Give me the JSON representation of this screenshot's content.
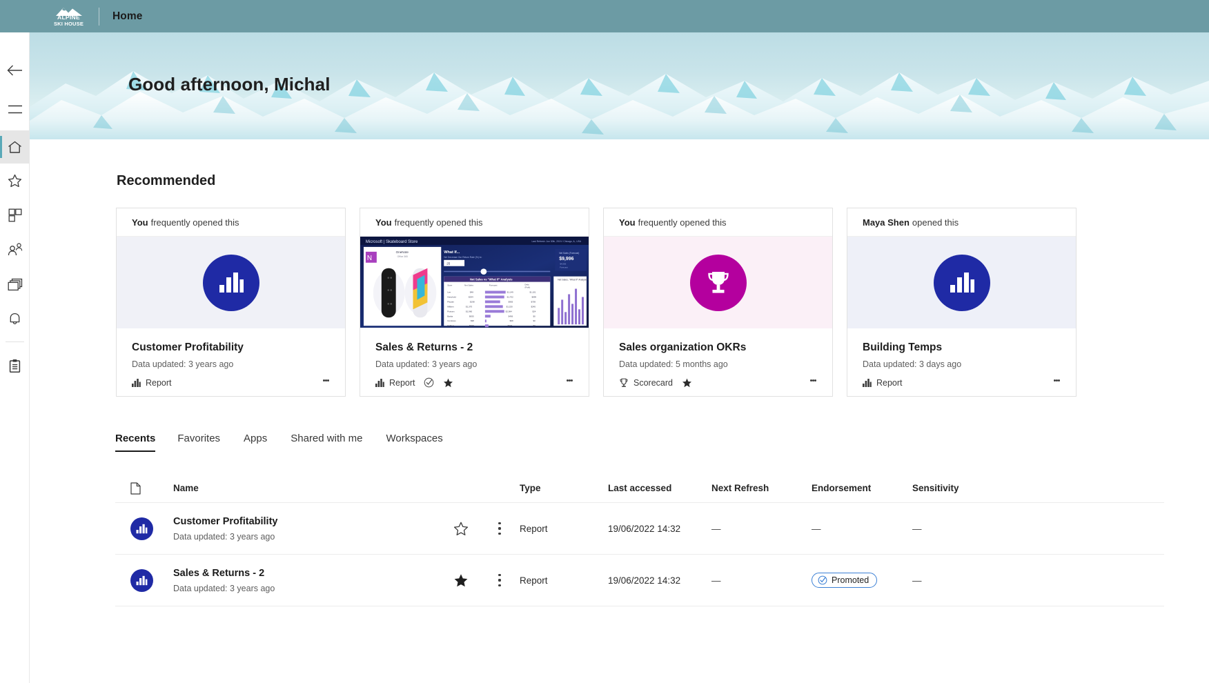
{
  "topbar": {
    "brand_line1": "ALPINE",
    "brand_line2": "SKI HOUSE",
    "brand_icon": "mountain-logo-icon",
    "title": "Home"
  },
  "rail": {
    "items": [
      {
        "label": "Back",
        "icon": "back-arrow-icon"
      },
      {
        "label": "Navigation",
        "icon": "hamburger-menu-icon"
      },
      {
        "label": "Home",
        "icon": "home-icon",
        "selected": true
      },
      {
        "label": "Favorites",
        "icon": "star-outline-icon"
      },
      {
        "label": "Browse",
        "icon": "grid-layout-icon"
      },
      {
        "label": "Data hub",
        "icon": "people-icon"
      },
      {
        "label": "Apps",
        "icon": "stacked-windows-icon"
      },
      {
        "label": "Notifications",
        "icon": "bell-icon"
      },
      {
        "label": "Metrics",
        "icon": "clipboard-list-icon"
      }
    ]
  },
  "hero": {
    "greeting": "Good afternoon, Michal",
    "image": "snowy-mountain-panorama"
  },
  "recommended": {
    "title": "Recommended",
    "cards": [
      {
        "actor": "You",
        "action": "frequently opened this",
        "thumb_style": "badge-chart-blue",
        "thumb_icon": "bar-chart-icon",
        "name": "Customer Profitability",
        "subtitle": "Data updated: 3 years ago",
        "type_icon": "bar-chart-icon",
        "type": "Report",
        "certified": false,
        "favorited": false,
        "kebab": "more-options-icon"
      },
      {
        "actor": "You",
        "action": "frequently opened this",
        "thumb_style": "report-preview",
        "thumb_icon": "report-thumbnail",
        "name": "Sales & Returns  - 2",
        "subtitle": "Data updated: 3 years ago",
        "type_icon": "bar-chart-icon",
        "type": "Report",
        "certified": true,
        "favorited": true,
        "kebab": "more-options-icon"
      },
      {
        "actor": "You",
        "action": "frequently opened this",
        "thumb_style": "badge-trophy-magenta",
        "thumb_icon": "trophy-icon",
        "name": "Sales organization OKRs",
        "subtitle": "Data updated: 5 months ago",
        "type_icon": "trophy-icon",
        "type": "Scorecard",
        "certified": false,
        "favorited": true,
        "kebab": "more-options-icon"
      },
      {
        "actor": "Maya Shen",
        "action": "opened this",
        "thumb_style": "badge-chart-blue",
        "thumb_icon": "bar-chart-icon",
        "name": "Building Temps",
        "subtitle": "Data updated: 3 days ago",
        "type_icon": "bar-chart-icon",
        "type": "Report",
        "certified": false,
        "favorited": false,
        "kebab": "more-options-icon"
      }
    ]
  },
  "tabs": [
    {
      "label": "Recents",
      "active": true
    },
    {
      "label": "Favorites",
      "active": false
    },
    {
      "label": "Apps",
      "active": false
    },
    {
      "label": "Shared with me",
      "active": false
    },
    {
      "label": "Workspaces",
      "active": false
    }
  ],
  "table": {
    "columns": {
      "icon": "file-icon",
      "name": "Name",
      "type": "Type",
      "last_accessed": "Last accessed",
      "next_refresh": "Next Refresh",
      "endorsement": "Endorsement",
      "sensitivity": "Sensitivity"
    },
    "rows": [
      {
        "icon": "bar-chart-icon",
        "name": "Customer Profitability",
        "subtitle": "Data updated: 3 years ago",
        "favorited": false,
        "star_icon": "star-outline-icon",
        "kebab": "more-options-icon",
        "type": "Report",
        "last_accessed": "19/06/2022 14:32",
        "next_refresh": "—",
        "endorsement": "—",
        "endorsement_badge": null,
        "sensitivity": "—"
      },
      {
        "icon": "bar-chart-icon",
        "name": "Sales & Returns  - 2",
        "subtitle": "Data updated: 3 years ago",
        "favorited": true,
        "star_icon": "star-filled-icon",
        "kebab": "more-options-icon",
        "type": "Report",
        "last_accessed": "19/06/2022 14:32",
        "next_refresh": "—",
        "endorsement": "Promoted",
        "endorsement_badge": "promoted-badge",
        "sensitivity": "—"
      }
    ]
  },
  "colors": {
    "topbar": "#6c9ba4",
    "accent_rail": "#5aa9b8",
    "badge_blue": "#1f2aa5",
    "badge_magenta": "#b4009e",
    "promoted_border": "#3a7fd5"
  }
}
